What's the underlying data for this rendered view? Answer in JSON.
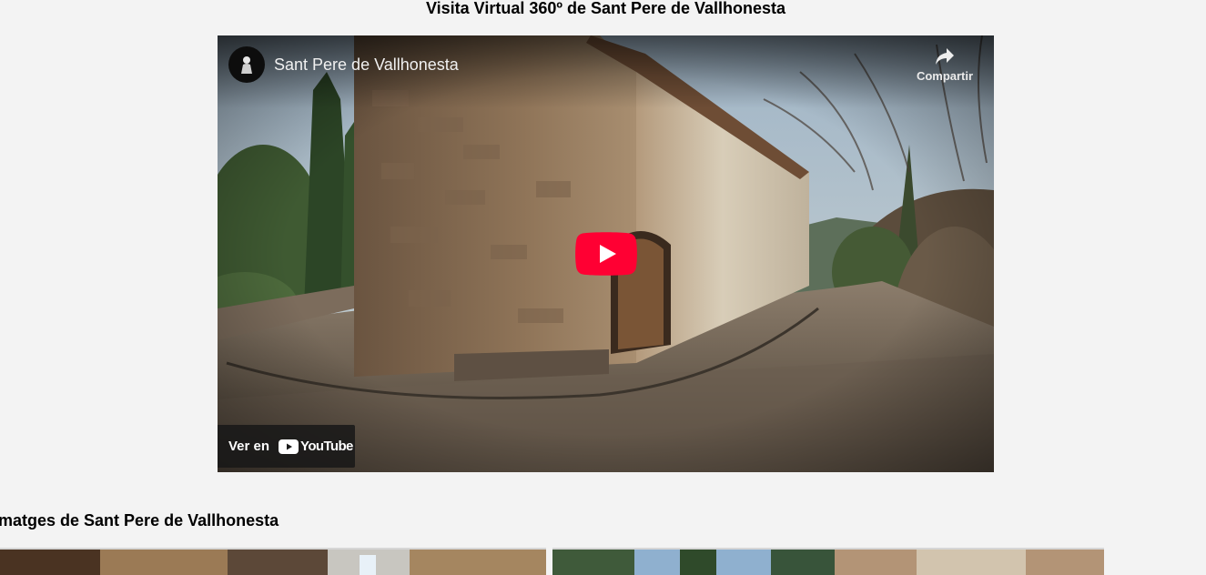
{
  "page": {
    "title": "Visita Virtual 360º de Sant Pere de Vallhonesta",
    "gallery_heading": "Imatges de Sant Pere de Vallhonesta"
  },
  "video": {
    "title": "Sant Pere de Vallhonesta",
    "share_label": "Compartir",
    "watch_on_label": "Ver en",
    "platform_name": "YouTube",
    "play_button_color": "#ff0033",
    "icons": {
      "avatar": "channel-avatar-icon",
      "share": "share-arrow-icon",
      "play": "play-icon",
      "logo": "youtube-logo-icon"
    }
  },
  "gallery": {
    "images": [
      {
        "name": "church-interior-photo"
      },
      {
        "name": "church-exterior-photo"
      }
    ]
  }
}
